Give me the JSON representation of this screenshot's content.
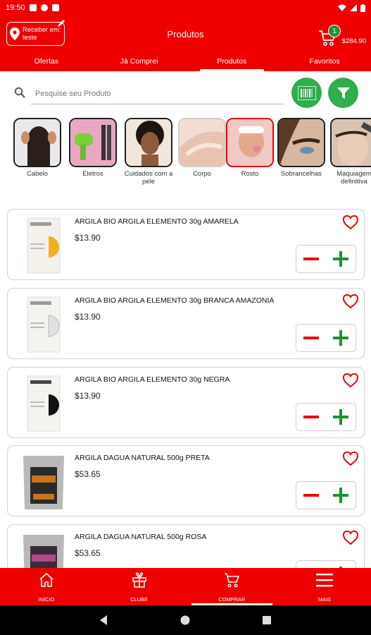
{
  "status_bar": {
    "time": "19:50"
  },
  "header": {
    "receive_label": "Receber em: teste",
    "title": "Produtos",
    "cart_count": "1",
    "cart_total": "$284.90"
  },
  "tabs": [
    {
      "label": "Ofertas"
    },
    {
      "label": "Já Comprei"
    },
    {
      "label": "Produtos",
      "active": true
    },
    {
      "label": "Favoritos"
    }
  ],
  "search": {
    "placeholder": "Pesquise seu Produto"
  },
  "categories": [
    {
      "label": "Cabelo"
    },
    {
      "label": "Eletros"
    },
    {
      "label": "Cuidados com a pele"
    },
    {
      "label": "Corpo"
    },
    {
      "label": "Rosto"
    },
    {
      "label": "Sobrancelhas"
    },
    {
      "label": "Maquiagem definitiva"
    }
  ],
  "products": [
    {
      "name": "ARGILA BIO ARGILA ELEMENTO 30g AMARELA",
      "price": "$13.90"
    },
    {
      "name": "ARGILA BIO ARGILA ELEMENTO 30g BRANCA AMAZONIA",
      "price": "$13.90"
    },
    {
      "name": "ARGILA BIO ARGILA ELEMENTO 30g NEGRA",
      "price": "$13.90"
    },
    {
      "name": "ARGILA DAGUA NATURAL 500g PRETA",
      "price": "$53.65"
    },
    {
      "name": "ARGILA DAGUA NATURAL 500g ROSA",
      "price": "$53.65"
    }
  ],
  "bottom_nav": [
    {
      "label": "INÍCIO",
      "icon": "home-icon"
    },
    {
      "label": "CLUBE",
      "icon": "gift-icon"
    },
    {
      "label": "COMPRAR",
      "icon": "cart-icon",
      "active": true
    },
    {
      "label": "MAIS",
      "icon": "menu-icon"
    }
  ],
  "colors": {
    "primary": "#ee0000",
    "accent_green": "#2eae4c",
    "badge_green": "#1f8f34"
  }
}
